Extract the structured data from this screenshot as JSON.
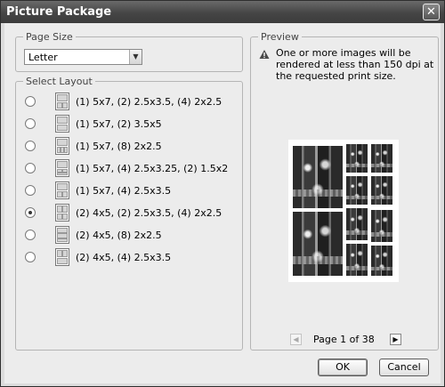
{
  "window": {
    "title": "Picture Package",
    "close_glyph": "✕"
  },
  "page_size": {
    "legend": "Page Size",
    "selected": "Letter"
  },
  "select_layout": {
    "legend": "Select Layout",
    "options": [
      {
        "label": "(1) 5x7, (2) 2.5x3.5, (4) 2x2.5",
        "checked": false
      },
      {
        "label": "(1) 5x7, (2) 3.5x5",
        "checked": false
      },
      {
        "label": "(1) 5x7, (8) 2x2.5",
        "checked": false
      },
      {
        "label": "(1) 5x7, (4) 2.5x3.25, (2) 1.5x2",
        "checked": false
      },
      {
        "label": "(1) 5x7, (4) 2.5x3.5",
        "checked": false
      },
      {
        "label": "(2) 4x5, (2) 2.5x3.5, (4) 2x2.5",
        "checked": true
      },
      {
        "label": "(2) 4x5, (8) 2x2.5",
        "checked": false
      },
      {
        "label": "(2) 4x5, (4) 2.5x3.5",
        "checked": false
      }
    ]
  },
  "preview": {
    "legend": "Preview",
    "warning_icon": "warning-triangle-icon",
    "warning": "One or more images will be rendered at less than 150 dpi at the requested print size.",
    "pager": {
      "text": "Page 1 of 38",
      "prev_icon": "◀",
      "next_icon": "▶"
    }
  },
  "buttons": {
    "ok": "OK",
    "cancel": "Cancel"
  }
}
